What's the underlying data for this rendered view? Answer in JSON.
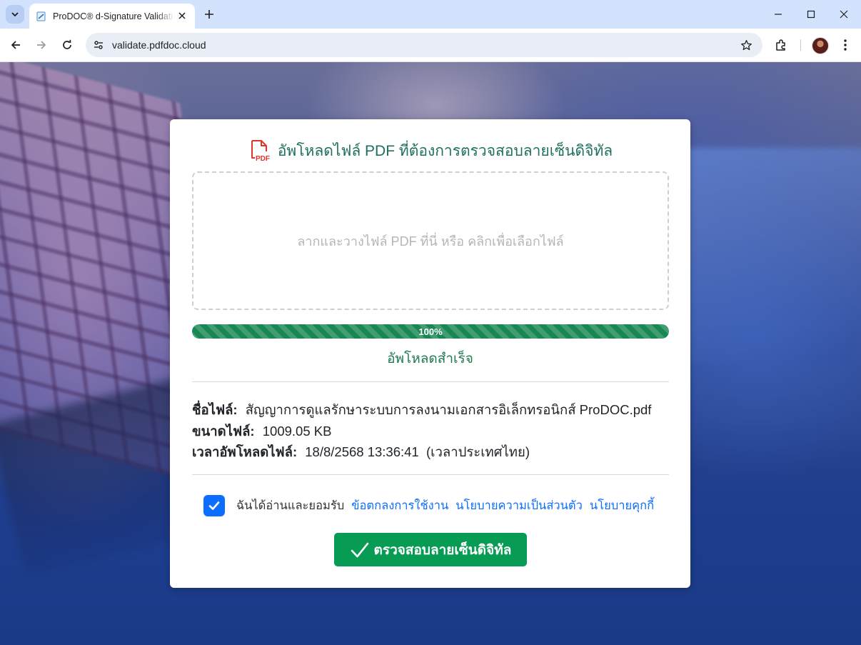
{
  "browser": {
    "tab_title": "ProDOC® d-Signature Validation",
    "url": "validate.pdfdoc.cloud"
  },
  "card": {
    "title": "อัพโหลดไฟล์ PDF ที่ต้องการตรวจสอบลายเซ็นดิจิทัล",
    "pdf_icon_label": "PDF",
    "dropzone_text": "ลากและวางไฟล์ PDF ที่นี่ หรือ คลิกเพื่อเลือกไฟล์",
    "progress": {
      "percent": 100,
      "label": "100%"
    },
    "upload_status": "อัพโหลดสำเร็จ",
    "file_info": {
      "name_label": "ชื่อไฟล์:",
      "name_value": "สัญญาการดูแลรักษาระบบการลงนามเอกสารอิเล็กทรอนิกส์ ProDOC.pdf",
      "size_label": "ขนาดไฟล์:",
      "size_value": "1009.05 KB",
      "time_label": "เวลาอัพโหลดไฟล์:",
      "time_value": "18/8/2568 13:36:41  (เวลาประเทศไทย)"
    },
    "consent": {
      "checked": true,
      "text": "ฉันได้อ่านและยอมรับ",
      "links": [
        "ข้อตกลงการใช้งาน",
        "นโยบายความเป็นส่วนตัว",
        "นโยบายคุกกี้"
      ]
    },
    "verify_button_label": "ตรวจสอบลายเซ็นดิจิทัล"
  },
  "colors": {
    "title": "#1f6f5f",
    "progress": "#198754",
    "status": "#1f7a4d",
    "link": "#0d6efd",
    "button": "#079b54"
  }
}
